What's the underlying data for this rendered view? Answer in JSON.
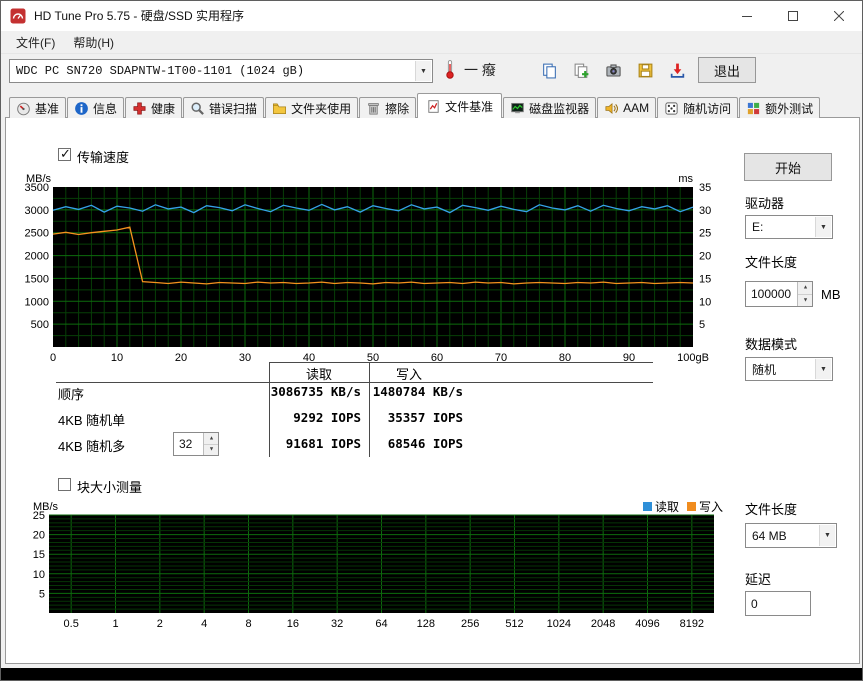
{
  "window": {
    "title": "HD Tune Pro 5.75 - 硬盘/SSD 实用程序"
  },
  "menu": {
    "file": "文件(F)",
    "help": "帮助(H)"
  },
  "toolbar": {
    "drive": "WDC PC SN720 SDAPNTW-1T00-1101 (1024 gB)",
    "temperature": "一 癈",
    "buttons": [
      {
        "name": "copy-screenshot",
        "icon": "copy-icon"
      },
      {
        "name": "add-screenshot",
        "icon": "copy-add-icon"
      },
      {
        "name": "capture-screenshot",
        "icon": "camera-icon"
      },
      {
        "name": "save-screenshot",
        "icon": "save-icon"
      },
      {
        "name": "export-results",
        "icon": "export-icon"
      }
    ],
    "exit_label": "退出"
  },
  "tabs": [
    {
      "id": "benchmark",
      "label": "基准",
      "icon": "gauge-icon"
    },
    {
      "id": "info",
      "label": "信息",
      "icon": "info-icon"
    },
    {
      "id": "health",
      "label": "健康",
      "icon": "health-icon"
    },
    {
      "id": "error-scan",
      "label": "错误扫描",
      "icon": "scan-icon"
    },
    {
      "id": "folder-usage",
      "label": "文件夹使用",
      "icon": "folder-icon"
    },
    {
      "id": "erase",
      "label": "擦除",
      "icon": "erase-icon"
    },
    {
      "id": "file-benchmark",
      "label": "文件基准",
      "icon": "file-benchmark-icon"
    },
    {
      "id": "disk-monitor",
      "label": "磁盘监视器",
      "icon": "disk-monitor-icon"
    },
    {
      "id": "aam",
      "label": "AAM",
      "icon": "aam-icon"
    },
    {
      "id": "random-access",
      "label": "随机访问",
      "icon": "random-icon"
    },
    {
      "id": "extra-tests",
      "label": "额外测试",
      "icon": "extra-tests-icon"
    }
  ],
  "active_tab": "文件基准",
  "transfer": {
    "checkbox_label": "传输速度",
    "checked": true,
    "start_label": "开始",
    "drive_label": "驱动器",
    "drive_value": "E:",
    "file_length_label": "文件长度",
    "file_length_value": "100000",
    "file_length_unit": "MB",
    "data_mode_label": "数据模式",
    "data_mode_value": "随机",
    "results": {
      "col_read": "读取",
      "col_write": "写入",
      "rows": [
        {
          "label": "顺序",
          "read": "3086735 KB/s",
          "write": "1480784 KB/s"
        },
        {
          "label": "4KB 随机单",
          "read": "9292 IOPS",
          "write": "35357 IOPS"
        },
        {
          "label": "4KB 随机多",
          "queue": "32",
          "read": "91681 IOPS",
          "write": "68546 IOPS"
        }
      ]
    }
  },
  "block": {
    "checkbox_label": "块大小测量",
    "checked": false,
    "legend": [
      {
        "label": "读取",
        "color": "#2e8fd8"
      },
      {
        "label": "写入",
        "color": "#f08c1e"
      }
    ],
    "file_length_label": "文件长度",
    "file_length_value": "64 MB",
    "delay_label": "延迟",
    "delay_value": "0"
  },
  "chart_data": [
    {
      "type": "line",
      "title": "传输速度",
      "xlabel": "gB",
      "ylabel_left": "MB/s",
      "ylabel_right": "ms",
      "xlim": [
        0,
        100
      ],
      "ylim_left": [
        0,
        3500
      ],
      "ylim_right": [
        0,
        35
      ],
      "x_ticks": [
        0,
        10,
        20,
        30,
        40,
        50,
        60,
        70,
        80,
        90,
        100
      ],
      "x_tick_labels": [
        "0",
        "10",
        "20",
        "30",
        "40",
        "50",
        "60",
        "70",
        "80",
        "90",
        "100gB"
      ],
      "y_ticks_left": [
        500,
        1000,
        1500,
        2000,
        2500,
        3000,
        3500
      ],
      "y_ticks_right": [
        5,
        10,
        15,
        20,
        25,
        30,
        35
      ],
      "bg": "#000000",
      "grid_major": "#0d6b0d",
      "grid_minor": "#073f07",
      "series": [
        {
          "name": "读取",
          "color": "#35a2e8",
          "x": [
            0,
            2,
            4,
            6,
            8,
            10,
            12,
            14,
            16,
            18,
            20,
            22,
            24,
            26,
            28,
            30,
            32,
            34,
            36,
            38,
            40,
            42,
            44,
            46,
            48,
            50,
            52,
            54,
            56,
            58,
            60,
            62,
            64,
            66,
            68,
            70,
            72,
            74,
            76,
            78,
            80,
            82,
            84,
            86,
            88,
            90,
            92,
            94,
            96,
            98,
            100
          ],
          "y": [
            2990,
            3070,
            3010,
            3100,
            2950,
            3080,
            3040,
            2970,
            3110,
            3020,
            3060,
            2940,
            3090,
            3050,
            2980,
            3110,
            3030,
            2960,
            3100,
            3040,
            2990,
            3120,
            3000,
            3070,
            2950,
            3090,
            3030,
            2980,
            3110,
            3020,
            3060,
            2940,
            3100,
            3050,
            2990,
            3080,
            3010,
            2960,
            3110,
            3040,
            3000,
            3090,
            2970,
            3100,
            3030,
            2980,
            3070,
            3020,
            3090,
            2960,
            3060
          ]
        },
        {
          "name": "写入",
          "color": "#f5921e",
          "x": [
            0,
            2,
            4,
            6,
            8,
            10,
            12,
            14,
            16,
            18,
            20,
            22,
            24,
            26,
            28,
            30,
            32,
            34,
            36,
            38,
            40,
            42,
            44,
            46,
            48,
            50,
            52,
            54,
            56,
            58,
            60,
            62,
            64,
            66,
            68,
            70,
            72,
            74,
            76,
            78,
            80,
            82,
            84,
            86,
            88,
            90,
            92,
            94,
            96,
            98,
            100
          ],
          "y": [
            2470,
            2510,
            2460,
            2500,
            2530,
            2560,
            2620,
            1430,
            1410,
            1390,
            1420,
            1400,
            1380,
            1410,
            1400,
            1390,
            1420,
            1400,
            1410,
            1390,
            1400,
            1420,
            1390,
            1410,
            1400,
            1380,
            1410,
            1400,
            1420,
            1390,
            1400,
            1410,
            1390,
            1420,
            1400,
            1410,
            1380,
            1400,
            1410,
            1400,
            1390,
            1410,
            1400,
            1420,
            1390,
            1400,
            1410,
            1390,
            1400,
            1410,
            1400
          ]
        }
      ]
    },
    {
      "type": "line",
      "title": "块大小测量",
      "ylabel": "MB/s",
      "categories": [
        "0.5",
        "1",
        "2",
        "4",
        "8",
        "16",
        "32",
        "64",
        "128",
        "256",
        "512",
        "1024",
        "2048",
        "4096",
        "8192"
      ],
      "ylim": [
        0,
        25
      ],
      "y_ticks": [
        5,
        10,
        15,
        20,
        25
      ],
      "bg": "#000000",
      "grid_major": "#0d6b0d",
      "grid_minor": "#063506",
      "legend_position": "top-right",
      "series": [
        {
          "name": "读取",
          "color": "#2e8fd8",
          "values": []
        },
        {
          "name": "写入",
          "color": "#f08c1e",
          "values": []
        }
      ]
    }
  ]
}
